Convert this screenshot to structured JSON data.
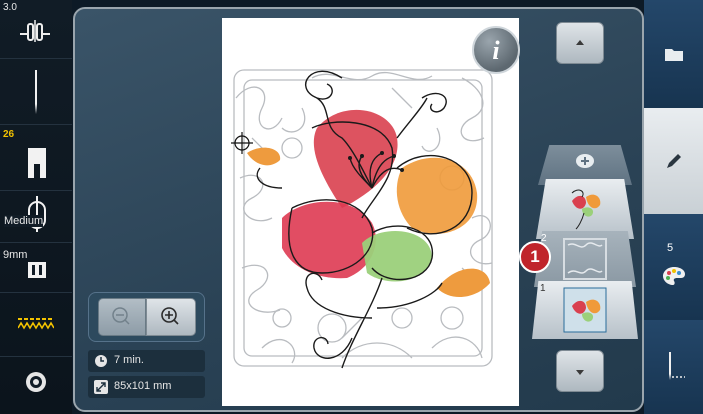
{
  "left_panel": {
    "tension_value": "3.0",
    "presser_foot_value": "26",
    "needle_stop_label": "Medium",
    "width_value": "9mm"
  },
  "info_panel": {
    "time": "7 min.",
    "size": "85x101 mm"
  },
  "layers": {
    "layer2_number": "2",
    "layer1_number": "1",
    "callout": "1"
  },
  "right_panel": {
    "color_count": "5"
  },
  "icons": [
    "thread-tension-icon",
    "needle-icon",
    "presser-foot-icon",
    "needle-stop-icon",
    "stitch-width-icon",
    "feed-dog-icon",
    "bobbin-icon",
    "info-icon",
    "scroll-up-icon",
    "scroll-down-icon",
    "zoom-out-icon",
    "zoom-in-icon",
    "clock-icon",
    "resize-icon",
    "folder-icon",
    "edit-pencil-icon",
    "color-palette-icon",
    "needle-threader-icon",
    "add-layer-icon",
    "crosshair-icon"
  ],
  "colors": {
    "accent_red": "#c0242b",
    "highlight_yellow": "#f2c200",
    "canvas_bg": "#ffffff"
  }
}
